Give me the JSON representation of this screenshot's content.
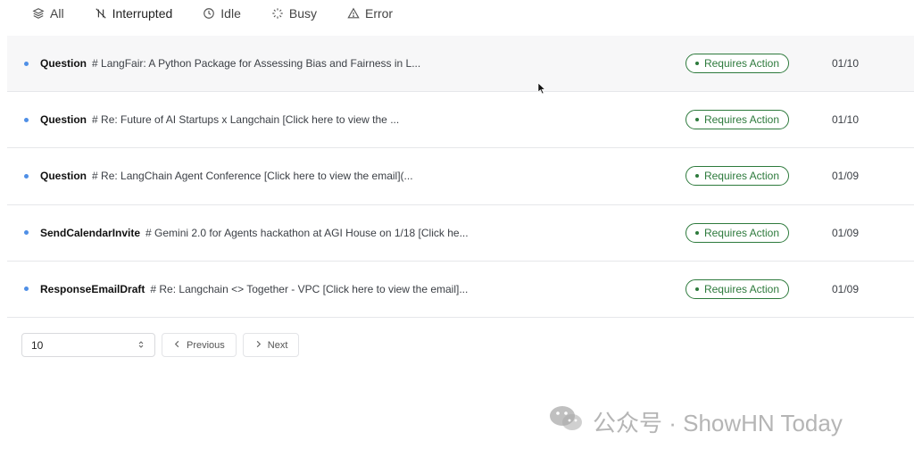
{
  "tabs": [
    {
      "label": "All",
      "icon": "layers-icon"
    },
    {
      "label": "Interrupted",
      "icon": "pause-off-icon"
    },
    {
      "label": "Idle",
      "icon": "clock-icon"
    },
    {
      "label": "Busy",
      "icon": "loader-icon"
    },
    {
      "label": "Error",
      "icon": "warning-icon"
    }
  ],
  "rows": [
    {
      "type": "Question",
      "desc": "# LangFair: A Python Package for Assessing Bias and Fairness in L...",
      "status": "Requires Action",
      "date": "01/10"
    },
    {
      "type": "Question",
      "desc": "# Re: Future of AI Startups x Langchain [Click here to view the ...",
      "status": "Requires Action",
      "date": "01/10"
    },
    {
      "type": "Question",
      "desc": "# Re: LangChain Agent Conference [Click here to view the email](...",
      "status": "Requires Action",
      "date": "01/09"
    },
    {
      "type": "SendCalendarInvite",
      "desc": "# Gemini 2.0 for Agents hackathon at AGI House on 1/18 [Click he...",
      "status": "Requires Action",
      "date": "01/09"
    },
    {
      "type": "ResponseEmailDraft",
      "desc": "# Re: Langchain <> Together - VPC [Click here to view the email]...",
      "status": "Requires Action",
      "date": "01/09"
    }
  ],
  "pagination": {
    "page_size": "10",
    "previous_label": "Previous",
    "next_label": "Next"
  },
  "watermark": {
    "text": "公众号 · ShowHN Today"
  },
  "colors": {
    "accent_blue": "#4f8fe6",
    "status_green": "#2d7a3c"
  }
}
